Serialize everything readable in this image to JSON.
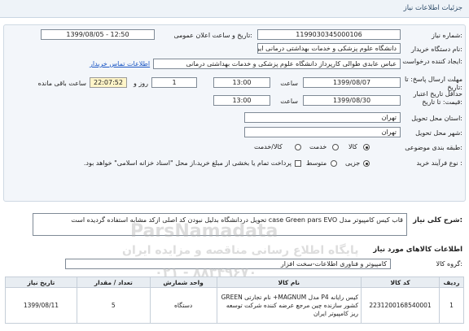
{
  "header": {
    "title": "جزئیات اطلاعات نیاز"
  },
  "form": {
    "need_number_label": "شماره نیاز:",
    "need_number": "1199030345000106",
    "announce_label": "تاریخ و ساعت اعلان عمومی:",
    "announce_value": "1399/08/05 - 12:50",
    "buyer_label": "نام دستگاه خریدار:",
    "buyer_value": "دانشگاه علوم پزشکی و خدمات بهداشتی درمانی ایران",
    "creator_label": "ایجاد کننده درخواست:",
    "creator_value": "عباس عابدی طوالی کارپرداز دانشگاه علوم پزشکی و خدمات بهداشتی درمانی",
    "contact_link": "اطلاعات تماس خریدار",
    "reply_deadline_label": "مهلت ارسال پاسخ: تا تاریخ:",
    "reply_date": "1399/08/07",
    "time_label": "ساعت",
    "reply_time": "13:00",
    "days_value": "1",
    "days_label": "روز و",
    "remaining_time": "22:07:52",
    "remaining_label": "ساعت باقی مانده",
    "validity_label": "حداقل تاریخ اعتبار قیمت: تا تاریخ:",
    "validity_date": "1399/08/30",
    "validity_time": "13:00",
    "province_label": "استان محل تحویل:",
    "province_value": "تهران",
    "city_label": "شهر محل تحویل:",
    "city_value": "تهران",
    "category_label": "طبقه بندی موضوعی:",
    "category_options": [
      "کالا",
      "خدمت",
      "کالا/خدمت"
    ],
    "category_selected": "کالا",
    "process_label": "نوع فرآیند خرید :",
    "process_options": [
      "جزیی",
      "متوسط"
    ],
    "process_selected": "جزیی",
    "payment_note": "پرداخت تمام یا بخشی از مبلغ خرید،از محل \"اسناد خزانه اسلامی\" خواهد بود."
  },
  "description": {
    "label": "شرح کلی نیاز:",
    "text": "قاب کیس کامپیوتر مدل case Green pars EVO تحویل دردانشگاه بدلیل نبودن کد اصلی ازکد مشابه استفاده گردیده است"
  },
  "goods_section": {
    "title": "اطلاعات کالاهای مورد نیاز",
    "group_label": "گروه کالا:",
    "group_value": "کامپیوتر و فناوری اطلاعات-سخت افزار"
  },
  "table": {
    "headers": [
      "ردیف",
      "کد کالا",
      "نام کالا",
      "واحد شمارش",
      "تعداد / مقدار",
      "تاریخ نیاز"
    ],
    "rows": [
      [
        "1",
        "2231200168540001",
        "کیس رایانه P4 مدل MAGNUM+ نام تجارتی GREEN کشور سازنده چین مرجع عرضه کننده شرکت توسعه ریز کامپیوتر ایران",
        "دستگاه",
        "5",
        "1399/08/11"
      ]
    ]
  },
  "watermark": {
    "line1": "ParsNamadata",
    "line2": "پایگاه اطلاع رسانی مناقصه و مزایده ایران",
    "line3": "۰۲۱ - ۸۸۳۴۹۶۷۰"
  }
}
